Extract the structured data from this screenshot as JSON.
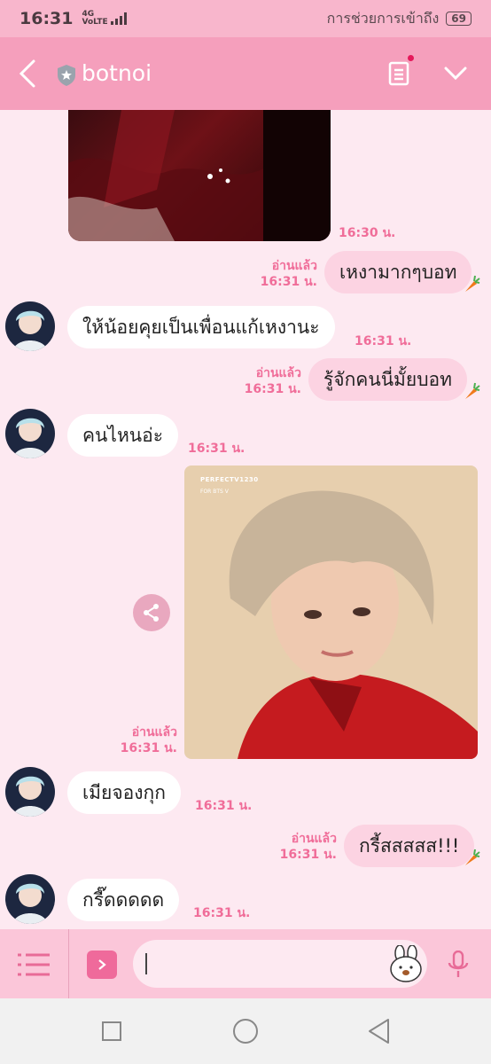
{
  "status_bar": {
    "time": "16:31",
    "network_top": "4G",
    "network_bottom": "VoLTE",
    "carrier_text": "การช่วยการเข้าถึง",
    "battery": "69"
  },
  "header": {
    "title": "botnoi",
    "back_icon": "chevron-left-icon",
    "note_icon": "notes-icon",
    "menu_icon": "chevron-down-icon"
  },
  "messages": {
    "m0_time": "16:30 น.",
    "m1_read": "อ่านแล้ว",
    "m1_time": "16:31 น.",
    "m1_text": "เหงามากๆบอท",
    "m2_text": "ให้น้อยคุยเป็นเพื่อนแก้เหงานะ",
    "m2_time": "16:31 น.",
    "m3_read": "อ่านแล้ว",
    "m3_time": "16:31 น.",
    "m3_text": "รู้จักคนนี่มั้ยบอท",
    "m4_text": "คนไหนอ่ะ",
    "m4_time": "16:31 น.",
    "m5_read": "อ่านแล้ว",
    "m5_time": "16:31 น.",
    "m5_photo_caption": "PERFECTV1230",
    "m5_photo_sub": "FOR BTS V",
    "m6_text": "เมียจองกุก",
    "m6_time": "16:31 น.",
    "m7_read": "อ่านแล้ว",
    "m7_time": "16:31 น.",
    "m7_text": "กรี้สสสสส!!!",
    "m8_text": "กรี๊ดดดดด",
    "m8_time": "16:31 น."
  },
  "input_bar": {
    "placeholder": "",
    "menu_icon": "menu-icon",
    "expand_icon": "chevron-right-icon",
    "sticker_icon": "sticker-icon",
    "mic_icon": "microphone-icon"
  },
  "nav_bar": {
    "recent_icon": "square-icon",
    "home_icon": "circle-icon",
    "back_icon": "triangle-back-icon"
  },
  "colors": {
    "header": "#f59fbc",
    "chat_bg": "#fde9f1",
    "outgoing": "#fcd3e2",
    "accent": "#f06d99"
  }
}
